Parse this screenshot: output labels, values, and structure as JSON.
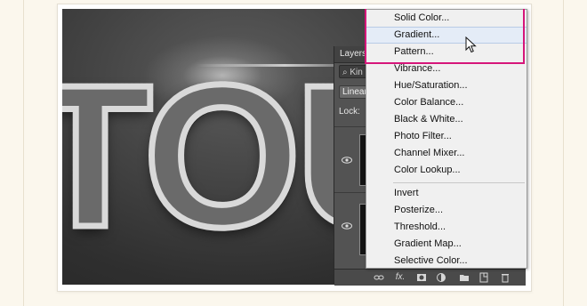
{
  "layers_panel": {
    "tab_label": "Layers",
    "kind_filter": "Kin",
    "blend_mode": "Linear",
    "lock_label": "Lock:",
    "footer_icons": [
      "link-icon",
      "fx-icon",
      "mask-icon",
      "adjustment-icon",
      "folder-icon",
      "new-layer-icon",
      "trash-icon"
    ],
    "footer_fx_label": "fx."
  },
  "canvas": {
    "text_art": "TOU"
  },
  "adjustment_menu": {
    "items_group1": [
      "Solid Color...",
      "Gradient...",
      "Pattern..."
    ],
    "items_group2": [
      "Vibrance...",
      "Hue/Saturation...",
      "Color Balance...",
      "Black & White...",
      "Photo Filter...",
      "Channel Mixer...",
      "Color Lookup..."
    ],
    "items_group3": [
      "Invert",
      "Posterize...",
      "Threshold...",
      "Gradient Map...",
      "Selective Color..."
    ],
    "hovered_item": "Gradient..."
  },
  "colors": {
    "highlight": "#d6167a",
    "menu_background": "#f0f0f0",
    "panel_background": "#535353"
  }
}
